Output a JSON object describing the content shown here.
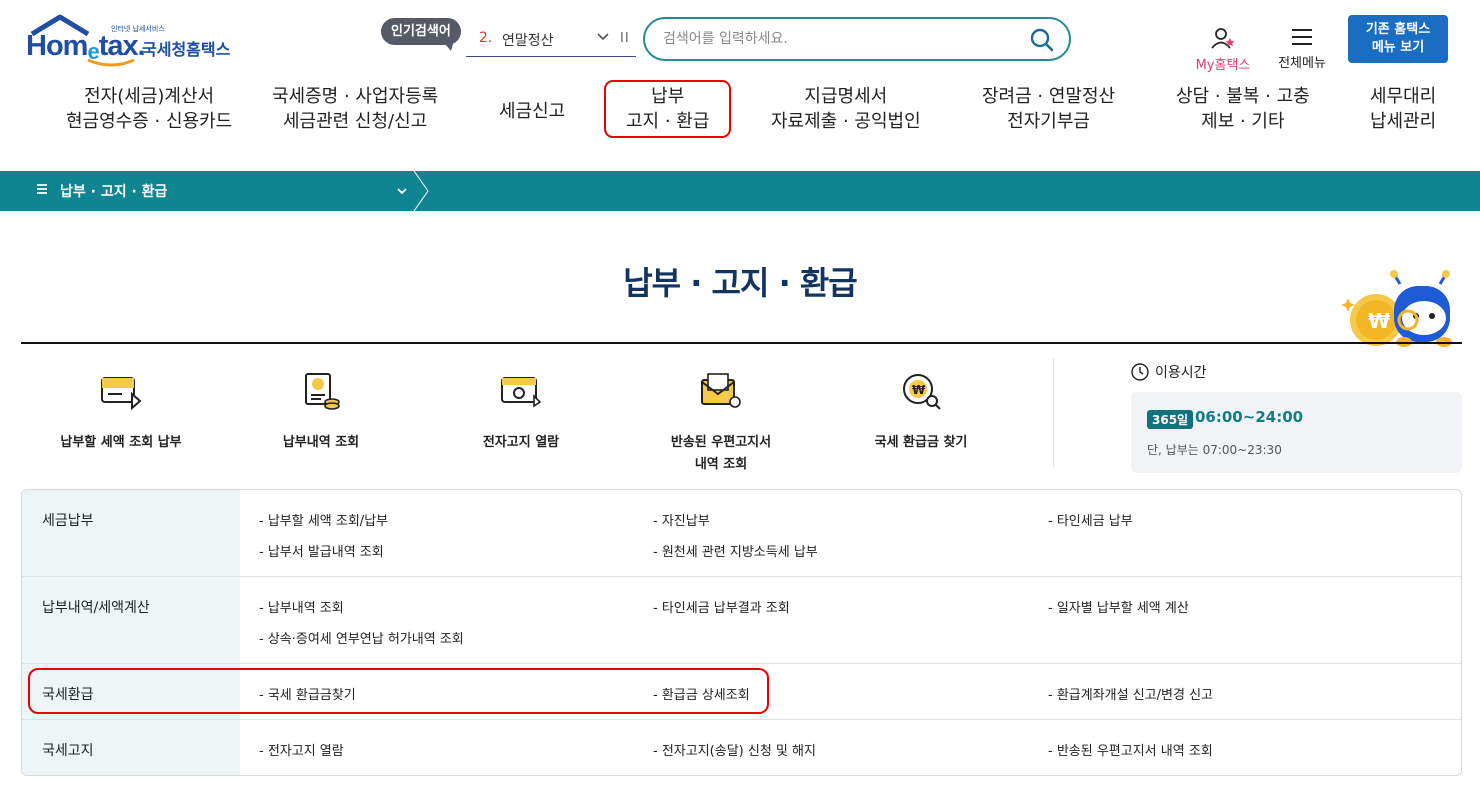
{
  "header": {
    "logo_main": "Hom",
    "logo_e": "e",
    "logo_tail": "tax.",
    "logo_sub": "인터넷 납세서비스",
    "logo_kor": "국세청홈택스",
    "popular_badge": "인기검색어",
    "popular_rank": "2.",
    "popular_word": "연말정산",
    "popular_pause": "II",
    "search_placeholder": "검색어를 입력하세요.",
    "my_hometax": "My홈택스",
    "all_menu": "전체메뉴",
    "old_menu_line1": "기존 홈택스",
    "old_menu_line2": "메뉴 보기"
  },
  "gnb": [
    {
      "line1": "전자(세금)계산서",
      "line2": "현금영수증 · 신용카드"
    },
    {
      "line1": "국세증명 · 사업자등록",
      "line2": "세금관련 신청/신고"
    },
    {
      "line1": "세금신고",
      "line2": ""
    },
    {
      "line1": "납부",
      "line2": "고지 · 환급"
    },
    {
      "line1": "지급명세서",
      "line2": "자료제출 · 공익법인"
    },
    {
      "line1": "장려금 · 연말정산",
      "line2": "전자기부금"
    },
    {
      "line1": "상담 · 불복 · 고충",
      "line2": "제보 · 기타"
    },
    {
      "line1": "세무대리",
      "line2": "납세관리"
    }
  ],
  "location": {
    "title": "납부 · 고지 · 환급"
  },
  "page": {
    "title": "납부 · 고지 · 환급"
  },
  "quick": [
    {
      "label": "납부할 세액 조회 납부",
      "label2": ""
    },
    {
      "label": "납부내역 조회",
      "label2": ""
    },
    {
      "label": "전자고지 열람",
      "label2": ""
    },
    {
      "label": "반송된 우편고지서",
      "label2": "내역 조회"
    },
    {
      "label": "국세 환급금 찾기",
      "label2": ""
    }
  ],
  "hours": {
    "title": "이용시간",
    "badge": "365일",
    "time": "06:00~24:00",
    "note": "단, 납부는 07:00~23:30"
  },
  "menu": [
    {
      "head": "세금납부",
      "links": [
        "- 납부할 세액 조회/납부",
        "- 자진납부",
        "- 타인세금 납부",
        "- 납부서 발급내역 조회",
        "- 원천세 관련 지방소득세 납부"
      ]
    },
    {
      "head": "납부내역/세액계산",
      "links": [
        "- 납부내역 조회",
        "- 타인세금 납부결과 조회",
        "- 일자별 납부할 세액 계산",
        "- 상속·증여세 연부연납 허가내역 조회"
      ]
    },
    {
      "head": "국세환급",
      "links": [
        "- 국세 환급금찾기",
        "- 환급금 상세조회",
        "- 환급계좌개설 신고/변경 신고"
      ]
    },
    {
      "head": "국세고지",
      "links": [
        "- 전자고지 열람",
        "- 전자고지(송달) 신청 및 해지",
        "- 반송된 우편고지서 내역 조회"
      ]
    }
  ],
  "colors": {
    "teal": "#0f8591",
    "navy": "#12345e",
    "highlight": "#ee0000",
    "button_blue": "#1b6dc1"
  }
}
